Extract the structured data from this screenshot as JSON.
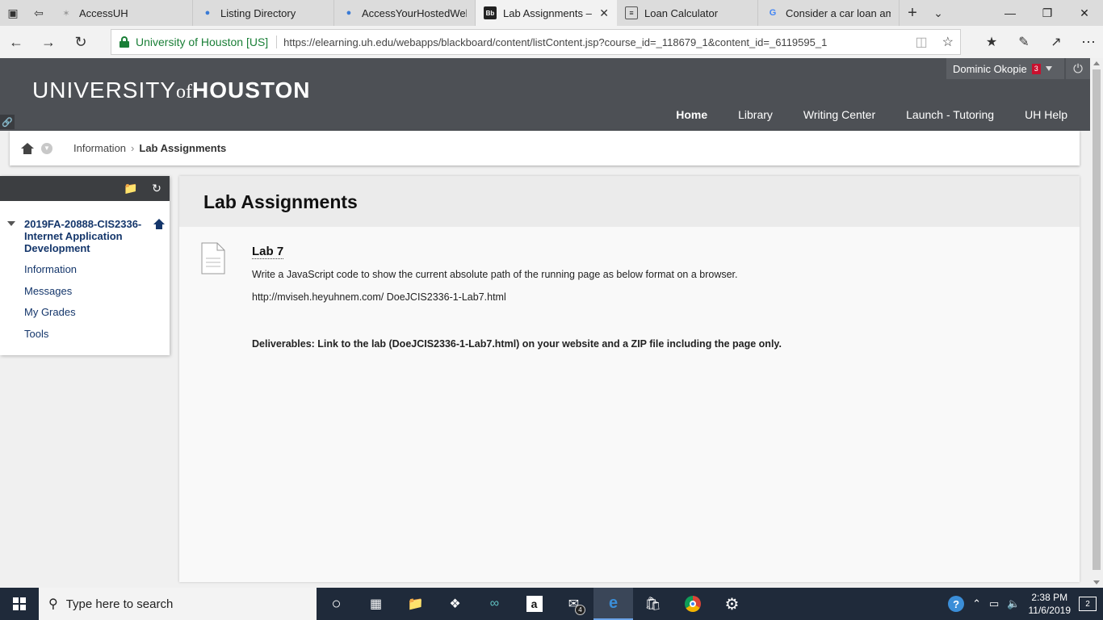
{
  "browser": {
    "tabs": [
      {
        "title": "AccessUH",
        "icon": "uh-icon"
      },
      {
        "title": "Listing Directory",
        "icon": "people-icon"
      },
      {
        "title": "AccessYourHostedWeb",
        "icon": "people-icon"
      },
      {
        "title": "Lab Assignments –",
        "icon": "bb-icon",
        "active": true
      },
      {
        "title": "Loan Calculator",
        "icon": "page-icon"
      },
      {
        "title": "Consider a car loan am",
        "icon": "google-icon"
      }
    ],
    "site_identity": "University of Houston [US]",
    "url": "https://elearning.uh.edu/webapps/blackboard/content/listContent.jsp?course_id=_118679_1&content_id=_6119595_1"
  },
  "header": {
    "logo_part1": "UNIVERSITY",
    "logo_part2": "of",
    "logo_part3": "HOUSTON",
    "user_name": "Dominic Okopie",
    "notification_count": "3",
    "nav": [
      {
        "label": "Home",
        "active": true
      },
      {
        "label": "Library"
      },
      {
        "label": "Writing Center"
      },
      {
        "label": "Launch - Tutoring"
      },
      {
        "label": "UH Help"
      }
    ]
  },
  "breadcrumb": {
    "parent": "Information",
    "current": "Lab Assignments"
  },
  "sidebar": {
    "course_title": "2019FA-20888-CIS2336-Internet Application Development",
    "links": [
      "Information",
      "Messages",
      "My Grades",
      "Tools"
    ]
  },
  "main": {
    "page_title": "Lab Assignments",
    "item": {
      "title": "Lab 7",
      "description": "Write a JavaScript code to show the current absolute path of the running page as below format on a browser.",
      "example_url": "http://mviseh.heyuhnem.com/ DoeJCIS2336-1-Lab7.html",
      "deliverables": "Deliverables: Link to the lab (DoeJCIS2336-1-Lab7.html) on your website and a ZIP file including the page only."
    }
  },
  "taskbar": {
    "search_placeholder": "Type here to search",
    "mail_count": "4",
    "time": "2:38 PM",
    "date": "11/6/2019",
    "notifications": "2"
  },
  "colors": {
    "header_bg": "#4d5055",
    "link_blue": "#14366b",
    "badge_red": "#c8102e",
    "secure_green": "#1a7f37"
  }
}
